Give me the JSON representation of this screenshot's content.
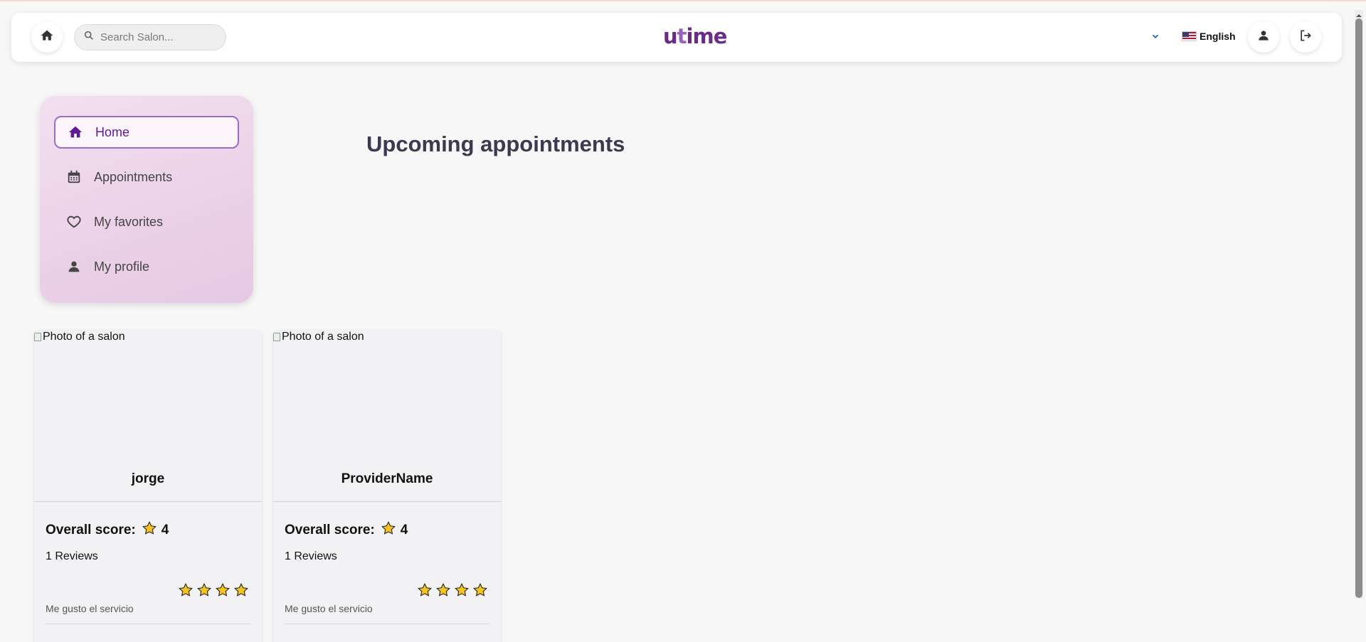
{
  "header": {
    "home_icon": "home-icon",
    "search_placeholder": "Search Salon...",
    "logo_prefix": "u",
    "logo_t": "t",
    "logo_suffix": "ime",
    "language": "English",
    "icons": [
      "chevron-down-icon",
      "flag-us-icon",
      "account-icon",
      "logout-icon"
    ]
  },
  "sidebar": {
    "items": [
      {
        "label": "Home",
        "icon": "home-icon",
        "active": true
      },
      {
        "label": "Appointments",
        "icon": "calendar-icon",
        "active": false
      },
      {
        "label": "My favorites",
        "icon": "heart-icon",
        "active": false
      },
      {
        "label": "My profile",
        "icon": "person-icon",
        "active": false
      }
    ]
  },
  "main": {
    "title": "Upcoming appointments"
  },
  "cards": [
    {
      "photo_alt": "Photo of a salon",
      "provider": "jorge",
      "score_label": "Overall score:",
      "score": "4",
      "reviews": "1 Reviews",
      "rating": 4,
      "comment": "Me gusto el servicio"
    },
    {
      "photo_alt": "Photo of a salon",
      "provider": "ProviderName",
      "score_label": "Overall score:",
      "score": "4",
      "reviews": "1 Reviews",
      "rating": 4,
      "comment": "Me gusto el servicio"
    }
  ],
  "colors": {
    "brand": "#6b2a83",
    "active_border": "#9a6cc9",
    "star": "#f6c21c"
  }
}
